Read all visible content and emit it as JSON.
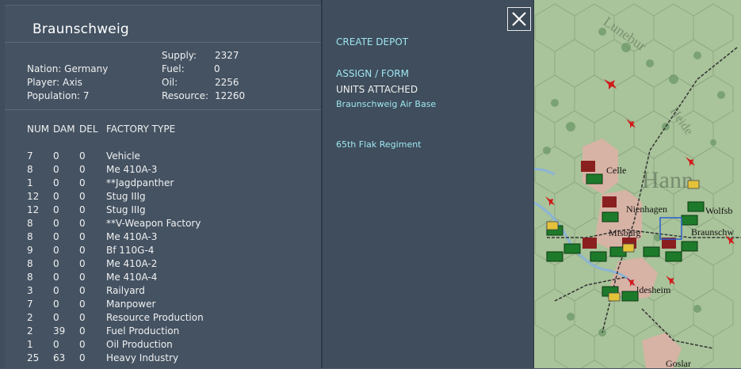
{
  "city": {
    "name": "Braunschweig",
    "nation_label": "Nation: Germany",
    "player_label": "Player: Axis",
    "population_label": "Population: 7"
  },
  "stats": [
    {
      "label": "Supply:",
      "value": "2327"
    },
    {
      "label": "Fuel:",
      "value": "0"
    },
    {
      "label": "Oil:",
      "value": "2256"
    },
    {
      "label": "Resource:",
      "value": "12260"
    }
  ],
  "table": {
    "headers": [
      "NUM",
      "DAM",
      "DEL",
      "FACTORY TYPE"
    ],
    "rows": [
      {
        "num": "7",
        "dam": "0",
        "del": "0",
        "type": "Vehicle"
      },
      {
        "num": "8",
        "dam": "0",
        "del": "0",
        "type": "Me 410A-3"
      },
      {
        "num": "1",
        "dam": "0",
        "del": "0",
        "type": "**Jagdpanther"
      },
      {
        "num": "12",
        "dam": "0",
        "del": "0",
        "type": "Stug IIIg"
      },
      {
        "num": "12",
        "dam": "0",
        "del": "0",
        "type": "Stug IIIg"
      },
      {
        "num": "8",
        "dam": "0",
        "del": "0",
        "type": "**V-Weapon Factory"
      },
      {
        "num": "8",
        "dam": "0",
        "del": "0",
        "type": "Me 410A-3"
      },
      {
        "num": "9",
        "dam": "0",
        "del": "0",
        "type": "Bf 110G-4"
      },
      {
        "num": "8",
        "dam": "0",
        "del": "0",
        "type": "Me 410A-2"
      },
      {
        "num": "8",
        "dam": "0",
        "del": "0",
        "type": "Me 410A-4"
      },
      {
        "num": "3",
        "dam": "0",
        "del": "0",
        "type": "Railyard"
      },
      {
        "num": "7",
        "dam": "0",
        "del": "0",
        "type": "Manpower"
      },
      {
        "num": "2",
        "dam": "0",
        "del": "0",
        "type": "Resource Production"
      },
      {
        "num": "2",
        "dam": "39",
        "del": "0",
        "type": "Fuel Production",
        "dam_highlight": true
      },
      {
        "num": "1",
        "dam": "0",
        "del": "0",
        "type": "Oil Production"
      },
      {
        "num": "25",
        "dam": "63",
        "del": "0",
        "type": "Heavy Industry",
        "dam_highlight": true
      }
    ]
  },
  "actions": {
    "create_depot": "CREATE DEPOT",
    "assign_form": "ASSIGN / FORM",
    "units_attached": "UNITS ATTACHED",
    "units": [
      "Braunschweig Air Base",
      "65th Flak Regiment"
    ]
  },
  "map": {
    "labels": [
      "Celle",
      "Nienhagen",
      "Wolfsb",
      "Misburg",
      "Braunschw",
      "ldesheim",
      "Hann",
      "Lunebur",
      "Heide",
      "Goslar"
    ]
  },
  "colors": {
    "panel": "#3f4d5c",
    "accent": "#9fe6f2",
    "map_green": "#a9c39a",
    "urban": "#d7b3a5",
    "unit_green": "#1d7a2a"
  },
  "close_icon": "close-icon"
}
